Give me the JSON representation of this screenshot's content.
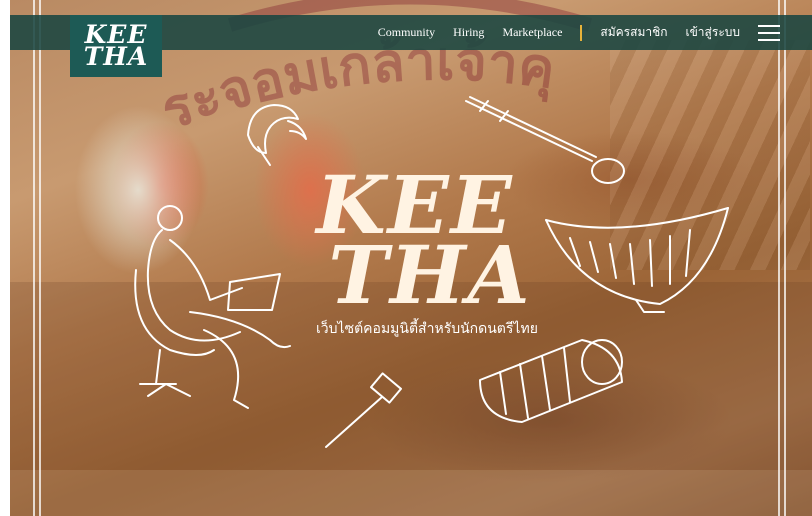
{
  "logo": {
    "line1": "KEE",
    "line2": "THA"
  },
  "nav": {
    "items": [
      "Community",
      "Hiring",
      "Marketplace"
    ],
    "register": "สมัครสมาชิก",
    "login": "เข้าสู่ระบบ"
  },
  "hero": {
    "title_line1": "KEE",
    "title_line2": "THA",
    "tagline": "เว็บไซต์คอมมูนิตี้สำหรับนักดนตรีไทย"
  },
  "watermark": {
    "text": "ระจอมเกล้าเจ้าคุ"
  },
  "icons": [
    "woman-with-laptop-sketch",
    "fiddle-sketch",
    "xylophone-sketch",
    "drum-sketch",
    "mallet-sketch",
    "gong-sketch",
    "menu-icon"
  ],
  "colors": {
    "nav_bg": "#19463f",
    "logo_bg": "#1d5a55",
    "accent_separator": "#e7b23a",
    "title": "#fff3e3"
  }
}
